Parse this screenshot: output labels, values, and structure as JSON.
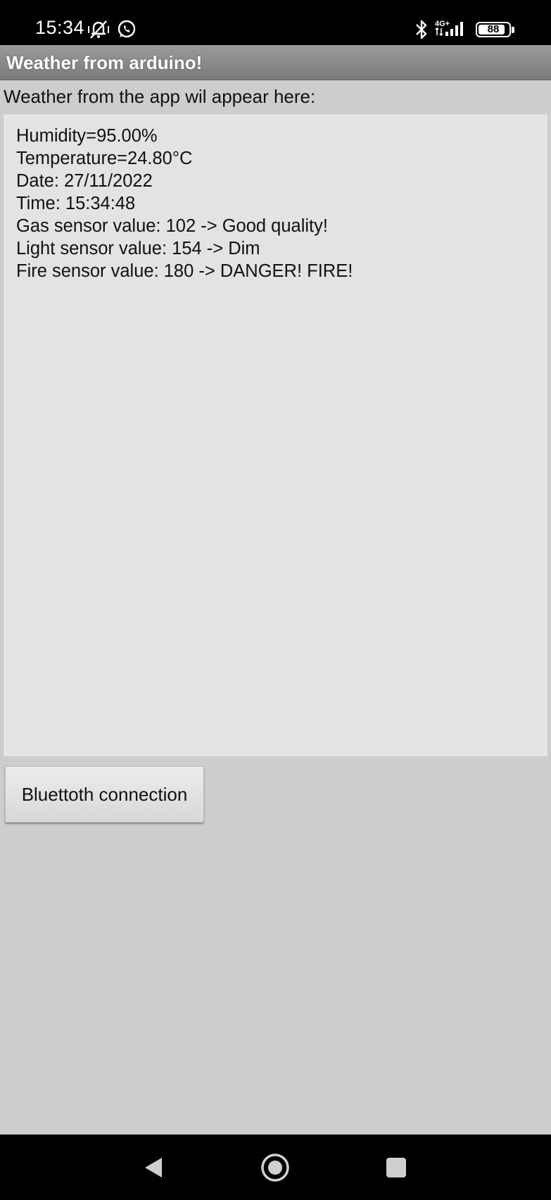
{
  "status_bar": {
    "time": "15:34",
    "battery": "88",
    "battery_level": 0.88,
    "network": "4G+",
    "icons": [
      "silent-mode-icon",
      "whatsapp-icon",
      "bluetooth-icon",
      "signal-icon",
      "battery-icon"
    ]
  },
  "app": {
    "title": "Weather from arduino!",
    "prompt": "Weather from the app wil appear here:",
    "output_lines": [
      "Humidity=95.00%",
      "Temperature=24.80°C",
      "Date: 27/11/2022",
      "Time: 15:34:48",
      "Gas sensor value: 102 -> Good quality!",
      "Light sensor value: 154 -> Dim",
      "Fire sensor value: 180 -> DANGER! FIRE!"
    ],
    "bluetooth_button_label": "Bluettoth connection"
  },
  "nav_bar": {
    "buttons": [
      "back-icon",
      "home-icon",
      "recents-icon"
    ]
  },
  "colors": {
    "background": "#cdcdcd",
    "output_background": "#e3e3e3",
    "title_bar": "#8a8a8a",
    "system_bars": "#000000"
  }
}
